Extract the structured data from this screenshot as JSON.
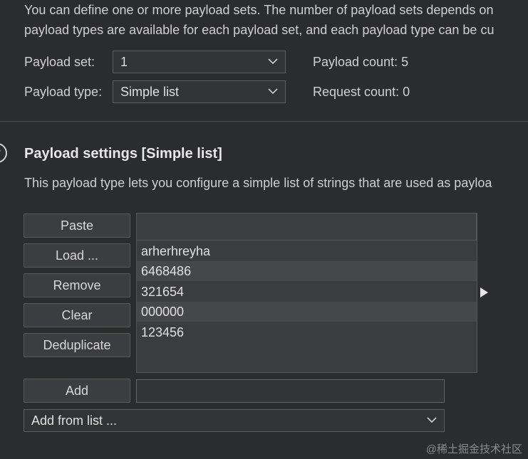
{
  "intro": {
    "line1": "You can define one or more payload sets. The number of payload sets depends on",
    "line2": "payload types are available for each payload set, and each payload type can be cu"
  },
  "payload_set": {
    "label": "Payload set:",
    "value": "1"
  },
  "payload_type": {
    "label": "Payload type:",
    "value": "Simple list"
  },
  "payload_count": {
    "label": "Payload count:",
    "value": "5"
  },
  "request_count": {
    "label": "Request count:",
    "value": "0"
  },
  "settings": {
    "help_icon": "?",
    "title": "Payload settings [Simple list]",
    "description": "This payload type lets you configure a simple list of strings that are used as payloa"
  },
  "buttons": {
    "paste": "Paste",
    "load": "Load ...",
    "remove": "Remove",
    "clear": "Clear",
    "deduplicate": "Deduplicate",
    "add": "Add"
  },
  "payload_list": [
    "arherhreyha",
    "6468486",
    "321654",
    "000000",
    "123456"
  ],
  "add_input": {
    "value": ""
  },
  "add_from_list": {
    "value": "Add from list ..."
  },
  "watermark": "@稀土掘金技术社区",
  "icons": {
    "dropdown": "chevron-down-icon",
    "help": "help-icon",
    "expand": "triangle-right-icon"
  },
  "colors": {
    "background": "#2b2c2e",
    "input_focus_border": "#3b6e9a"
  }
}
